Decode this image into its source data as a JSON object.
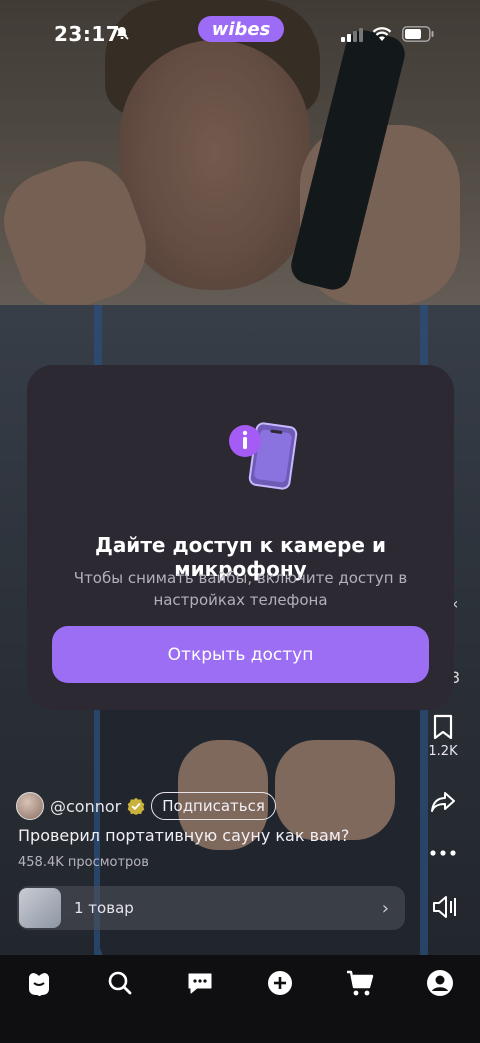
{
  "status_bar": {
    "time": "23:17",
    "brand": "wibes"
  },
  "dialog": {
    "title": "Дайте доступ к камере и микрофону",
    "subtitle": "Чтобы снимать вайбы, включите доступ в настройках телефона",
    "button_label": "Открыть доступ",
    "illustration_icon": "phone-info-icon"
  },
  "rail": {
    "bookmark_count": "1.2K",
    "partial_count": "3"
  },
  "post": {
    "username": "@connor",
    "follow_label": "Подписаться",
    "caption": "Проверил портативную сауну как вам?",
    "views": "458.4K просмотров"
  },
  "product_bar": {
    "label": "1 товар"
  },
  "tabbar": {
    "items": [
      "home-icon",
      "search-icon",
      "chat-icon",
      "add-icon",
      "cart-icon",
      "profile-icon"
    ]
  },
  "colors": {
    "accent": "#9b6ef4",
    "modal_bg": "#2c2933",
    "tabbar_bg": "#0f0f12"
  }
}
